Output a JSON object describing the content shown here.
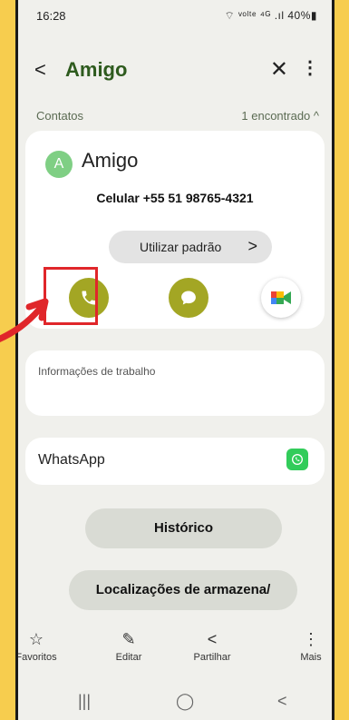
{
  "status": {
    "time": "16:28",
    "right": "⌔ ᵛᵒˡᵗᵉ ⁴ᴳ .ıl 40%▮"
  },
  "appbar": {
    "back": "<",
    "title": "Amigo",
    "close": "✕",
    "more": "⋮"
  },
  "section": {
    "label": "Contatos",
    "count": "1 encontrado ^"
  },
  "contact": {
    "initial": "A",
    "name": "Amigo",
    "phone": "Celular +55 51 98765-4321",
    "default_button": "Utilizar padrão",
    "chevron": ">"
  },
  "work": {
    "label": "Informações de trabalho"
  },
  "whatsapp": {
    "label": "WhatsApp"
  },
  "buttons": {
    "history": "Histórico",
    "locations": "Localizações de armazena/"
  },
  "bottom_nav": [
    {
      "icon": "☆",
      "label": "Favoritos"
    },
    {
      "icon": "✎",
      "label": "Editar"
    },
    {
      "icon": "<",
      "label": "Partilhar"
    },
    {
      "icon": "⋮",
      "label": "Mais"
    }
  ],
  "system_nav": {
    "recent": "|||",
    "home": "◯",
    "back": "<"
  },
  "colors": {
    "accent_green": "#a3a624",
    "highlight_red": "#e0262a",
    "background_yellow": "#f7cd4e"
  }
}
